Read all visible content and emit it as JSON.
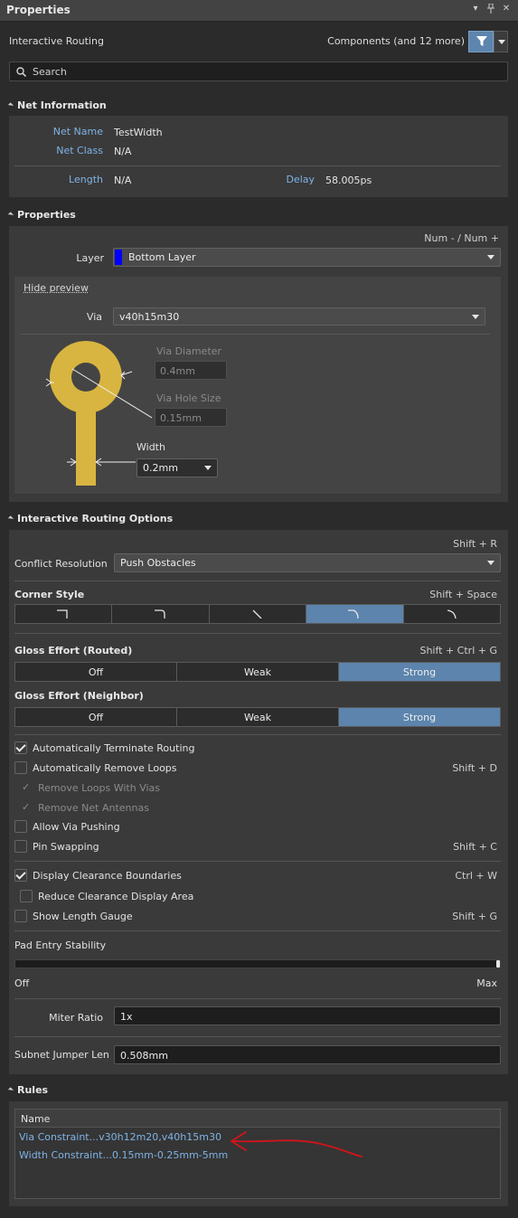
{
  "panel": {
    "title": "Properties",
    "header_icons": [
      "dropdown-arrow-icon",
      "pin-icon",
      "close-icon"
    ]
  },
  "header": {
    "mode": "Interactive Routing",
    "filter_summary": "Components (and 12 more)"
  },
  "search": {
    "placeholder": "Search"
  },
  "net_information": {
    "title": "Net Information",
    "net_name_label": "Net Name",
    "net_name_value": "TestWidth",
    "net_class_label": "Net Class",
    "net_class_value": "N/A",
    "length_label": "Length",
    "length_value": "N/A",
    "delay_label": "Delay",
    "delay_value": "58.005ps"
  },
  "properties": {
    "title": "Properties",
    "layer_shortcut": "Num - / Num +",
    "layer_label": "Layer",
    "layer_value": "Bottom Layer",
    "layer_color": "#0000ff",
    "hide_preview": "Hide preview",
    "via_label": "Via",
    "via_value": "v40h15m30",
    "via_diameter_label": "Via Diameter",
    "via_diameter_value": "0.4mm",
    "via_hole_label": "Via Hole Size",
    "via_hole_value": "0.15mm",
    "width_label": "Width",
    "width_value": "0.2mm",
    "graphic_color": "#d8b540"
  },
  "routing_options": {
    "title": "Interactive Routing Options",
    "conflict_shortcut": "Shift + R",
    "conflict_label": "Conflict Resolution",
    "conflict_value": "Push Obstacles",
    "corner_label": "Corner Style",
    "corner_shortcut": "Shift + Space",
    "corner_options": [
      "corner-90-icon",
      "corner-90-arc-icon",
      "corner-45-icon",
      "corner-45-arc-icon",
      "corner-any-icon"
    ],
    "corner_selected": 3,
    "gloss_routed_label": "Gloss Effort (Routed)",
    "gloss_routed_shortcut": "Shift + Ctrl + G",
    "gloss_options": [
      "Off",
      "Weak",
      "Strong"
    ],
    "gloss_routed_selected": "Strong",
    "gloss_neighbor_label": "Gloss Effort (Neighbor)",
    "gloss_neighbor_selected": "Strong",
    "checkboxes": {
      "auto_terminate": {
        "label": "Automatically Terminate Routing",
        "checked": true
      },
      "auto_remove_loops": {
        "label": "Automatically Remove Loops",
        "checked": false,
        "shortcut": "Shift + D"
      },
      "remove_loops_vias": {
        "label": "Remove Loops With Vias",
        "checked": true,
        "disabled": true
      },
      "remove_antennas": {
        "label": "Remove Net Antennas",
        "checked": true,
        "disabled": true
      },
      "allow_via_pushing": {
        "label": "Allow Via Pushing",
        "checked": false
      },
      "pin_swapping": {
        "label": "Pin Swapping",
        "checked": false,
        "shortcut": "Shift + C"
      },
      "display_clearance": {
        "label": "Display Clearance Boundaries",
        "checked": true,
        "shortcut": "Ctrl + W"
      },
      "reduce_clearance": {
        "label": "Reduce Clearance Display Area",
        "checked": false
      },
      "length_gauge": {
        "label": "Show Length Gauge",
        "checked": false,
        "shortcut": "Shift + G"
      }
    },
    "pad_entry_label": "Pad Entry Stability",
    "pad_entry_level": 1.0,
    "pad_entry_min": "Off",
    "pad_entry_max": "Max",
    "miter_label": "Miter Ratio",
    "miter_value": "1x",
    "subnet_label": "Subnet Jumper Len",
    "subnet_value": "0.508mm"
  },
  "rules": {
    "title": "Rules",
    "column_header": "Name",
    "items": [
      "Via Constraint...v30h12m20,v40h15m30",
      "Width Constraint...0.15mm-0.25mm-5mm"
    ]
  },
  "annotation": {
    "arrow_color": "#d4141a"
  }
}
